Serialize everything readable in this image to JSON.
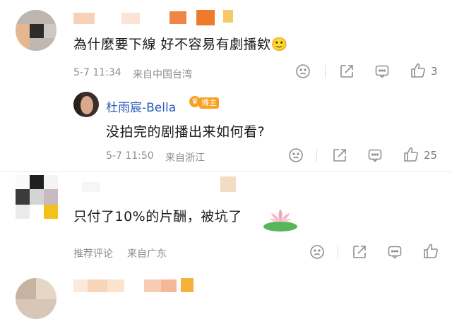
{
  "comments": [
    {
      "text": "為什麼要下線 好不容易有劇播欸🙂",
      "date": "5-7 11:34",
      "location": "来自中国台湾",
      "likes": "3"
    },
    {
      "username": "杜雨宸-Bella",
      "badge": "博主",
      "text": "没拍完的剧播出来如何看?",
      "date": "5-7 11:50",
      "location": "来自浙江",
      "likes": "25"
    },
    {
      "text": "只付了10%的片酬，被坑了",
      "date": "推荐评论",
      "location": "来自广东",
      "likes": ""
    }
  ],
  "icons": {
    "dislike": "sad-face-icon",
    "share": "share-icon",
    "comment": "comment-icon",
    "like": "thumbs-up-icon"
  },
  "colors": {
    "username_blue": "#2a5ab8",
    "badge_orange": "#f7a021",
    "meta_gray": "#8c8c8c"
  }
}
